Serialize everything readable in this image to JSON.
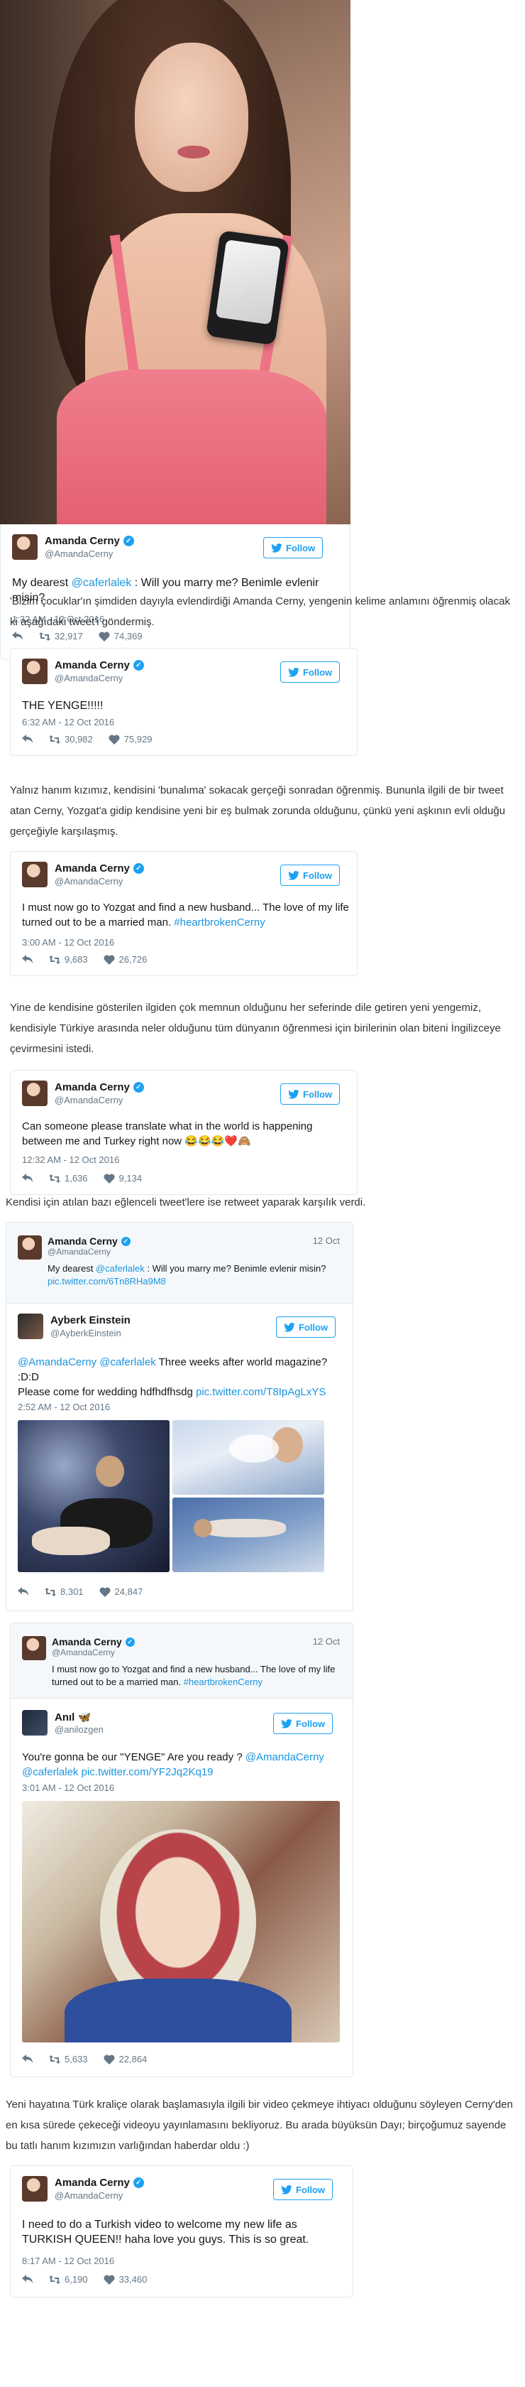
{
  "tweets": [
    {
      "name": "Amanda Cerny",
      "handle": "@AmandaCerny",
      "follow": "Follow",
      "text_pre": "My dearest ",
      "text_link": "@caferlalek",
      "text_post": " : Will you marry me? Benimle evlenir misin?",
      "time": "1:32 AM - 12 Oct 2016",
      "retweets": "32,917",
      "likes": "74,369"
    },
    {
      "name": "Amanda Cerny",
      "handle": "@AmandaCerny",
      "follow": "Follow",
      "text": "THE YENGE!!!!!",
      "time": "6:32 AM - 12 Oct 2016",
      "retweets": "30,982",
      "likes": "75,929"
    },
    {
      "name": "Amanda Cerny",
      "handle": "@AmandaCerny",
      "follow": "Follow",
      "text": "I must now go to Yozgat and find a new husband... The love of my life turned out to be a married man.",
      "hashtag": "#heartbrokenCerny",
      "time": "3:00 AM - 12 Oct 2016",
      "retweets": "9,683",
      "likes": "26,726"
    },
    {
      "name": "Amanda Cerny",
      "handle": "@AmandaCerny",
      "follow": "Follow",
      "text": "Can someone please translate what in the world is happening between me and Turkey right now 😂😂😂❤️🙈",
      "time": "12:32 AM - 12 Oct 2016",
      "retweets": "1,636",
      "likes": "9,134"
    },
    {
      "quote_name": "Amanda Cerny",
      "quote_handle": "@AmandaCerny",
      "quote_date": "12 Oct",
      "quote_pre": "My dearest ",
      "quote_link": "@caferlalek",
      "quote_post": " : Will you marry me? Benimle evlenir misin?",
      "quote_url": "pic.twitter.com/6Tn8RHa9M8",
      "name": "Ayberk Einstein",
      "handle": "@AyberkEinstein",
      "follow": "Follow",
      "mention1": "@AmandaCerny",
      "mention2": "@caferlalek",
      "text_a": " Three weeks after world magazine? :D:D",
      "text_b": "Please come for wedding hdfhdfhsdg ",
      "pic": "pic.twitter.com/T8IpAgLxYS",
      "time": "2:52 AM - 12 Oct 2016",
      "retweets": "8,301",
      "likes": "24,847"
    },
    {
      "quote_name": "Amanda Cerny",
      "quote_handle": "@AmandaCerny",
      "quote_date": "12 Oct",
      "quote_text": "I must now go to Yozgat and find a new husband... The love of my life turned out to be a married man.",
      "quote_hashtag": "#heartbrokenCerny",
      "name": "Anıl 🦋",
      "handle": "@anilozgen",
      "follow": "Follow",
      "text_a": "You're gonna be our \"YENGE\" Are you ready ? ",
      "mention1": "@AmandaCerny",
      "mention2": "@caferlalek",
      "pic": "pic.twitter.com/YF2Jq2Kq19",
      "time": "3:01 AM - 12 Oct 2016",
      "retweets": "5,633",
      "likes": "22,864"
    },
    {
      "name": "Amanda Cerny",
      "handle": "@AmandaCerny",
      "follow": "Follow",
      "text": "I need to do a Turkish video to welcome my new life as TURKISH QUEEN!! haha love you guys. This is so great.",
      "time": "8:17 AM - 12 Oct 2016",
      "retweets": "6,190",
      "likes": "33,460"
    }
  ],
  "paragraphs": [
    "'Bizim çocuklar'ın şimdiden dayıyla evlendirdiği Amanda Cerny, yengenin kelime anlamını öğrenmiş olacak ki aşağıdaki tweet'i göndermiş.",
    "Yalnız hanım kızımız, kendisini 'bunalıma' sokacak gerçeği sonradan öğrenmiş. Bununla ilgili de bir tweet atan Cerny, Yozgat'a gidip kendisine yeni bir eş bulmak zorunda olduğunu, çünkü yeni aşkının evli olduğu gerçeğiyle karşılaşmış.",
    "Yine de kendisine gösterilen ilgiden çok memnun olduğunu her seferinde dile getiren yeni yengemiz, kendisiyle Türkiye arasında neler olduğunu tüm dünyanın öğrenmesi için birilerinin olan biteni İngilizceye çevirmesini istedi.",
    "Kendisi için atılan bazı eğlenceli tweet'lere ise retweet yaparak karşılık verdi.",
    "Yeni hayatına Türk kraliçe olarak başlamasıyla ilgili bir video çekmeye ihtiyacı olduğunu söyleyen Cerny'den en kısa sürede çekeceği videoyu yayınlamasını bekliyoruz. Bu arada büyüksün Dayı; birçoğumuz sayende bu tatlı hanım kızımızın varlığından haberdar oldu :)"
  ],
  "colors": {
    "link": "#1b95e0",
    "follow": "#1da1f2",
    "muted": "#657786"
  }
}
